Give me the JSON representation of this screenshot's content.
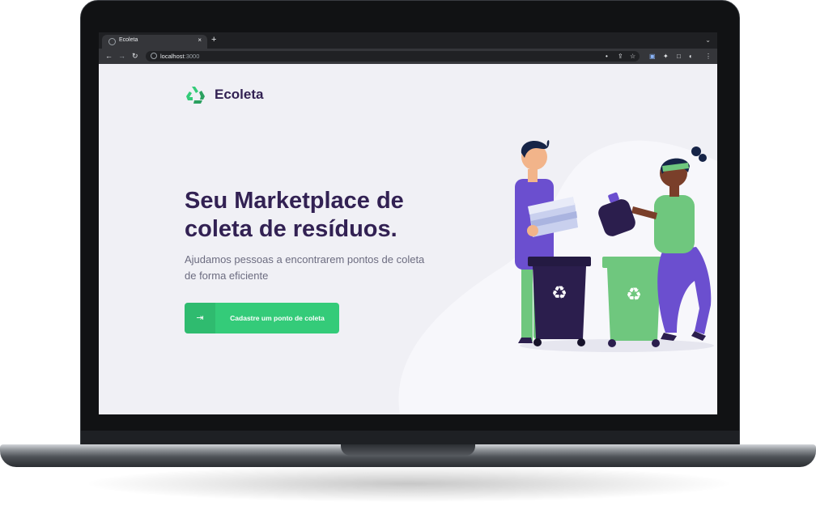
{
  "browser": {
    "tab_title": "Ecoleta",
    "tab_close": "×",
    "new_tab": "+",
    "tab_menu": "⌄",
    "nav": {
      "back": "←",
      "forward": "→",
      "reload": "↻"
    },
    "url_host": "localhost",
    "url_port": ":3000",
    "toolbar_icons": [
      "location-icon",
      "share-icon",
      "star-icon",
      "translate-icon",
      "extensions-icon",
      "sidepanel-icon",
      "profile-icon",
      "menu-icon"
    ]
  },
  "page": {
    "logo_text": "Ecoleta",
    "hero_title": "Seu Marketplace de coleta de resíduos.",
    "hero_subtitle": "Ajudamos pessoas a encontrarem pontos de coleta de forma eficiente",
    "cta_label": "Cadastre um ponto de coleta",
    "cta_icon": "log-in-icon"
  },
  "colors": {
    "primary": "#34cb79",
    "title": "#322153",
    "text": "#6c6c80",
    "background": "#f0f0f5",
    "bin_dark": "#2b1e4d",
    "bin_green": "#6fc77e",
    "shirt_purple": "#6b4fcf"
  }
}
